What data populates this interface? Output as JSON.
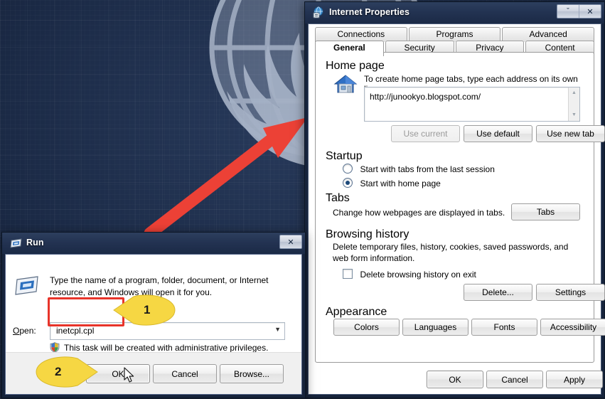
{
  "desktop": {
    "wallpaper_description": "dark navy grid wallpaper with UN-style globe and laurel emblem"
  },
  "annotations": {
    "arrow_color": "#ec4136",
    "badge_color": "#f6d743",
    "highlight_color": "#e8342a",
    "badges": [
      {
        "number": "1",
        "points": "left",
        "target": "run-open-input"
      },
      {
        "number": "2",
        "points": "right",
        "target": "run-ok-button"
      }
    ]
  },
  "internet_properties": {
    "title": "Internet Properties",
    "icon": "internet-options-icon",
    "titlebar_buttons": [
      {
        "name": "help-button",
        "glyph": "ˇ"
      },
      {
        "name": "close-button",
        "glyph": "✕"
      }
    ],
    "tabs_row1": [
      {
        "label": "Connections",
        "active": false
      },
      {
        "label": "Programs",
        "active": false
      },
      {
        "label": "Advanced",
        "active": false
      }
    ],
    "tabs_row2": [
      {
        "label": "General",
        "active": true
      },
      {
        "label": "Security",
        "active": false
      },
      {
        "label": "Privacy",
        "active": false
      },
      {
        "label": "Content",
        "active": false
      }
    ],
    "home_page": {
      "group_label": "Home page",
      "icon": "house-icon",
      "description": "To create home page tabs, type each address on its own line.",
      "value": "http://junookyo.blogspot.com/",
      "scroll_up_glyph": "▲",
      "scroll_down_glyph": "▼",
      "buttons": [
        {
          "label": "Use current",
          "disabled": true
        },
        {
          "label": "Use default",
          "disabled": false
        },
        {
          "label": "Use new tab",
          "disabled": false
        }
      ]
    },
    "startup": {
      "group_label": "Startup",
      "options": [
        {
          "label": "Start with tabs from the last session",
          "selected": false
        },
        {
          "label": "Start with home page",
          "selected": true
        }
      ]
    },
    "tabs_section": {
      "group_label": "Tabs",
      "description": "Change how webpages are displayed in tabs.",
      "button": "Tabs"
    },
    "browsing_history": {
      "group_label": "Browsing history",
      "description": "Delete temporary files, history, cookies, saved passwords, and web form information.",
      "checkbox_label": "Delete browsing history on exit",
      "checkbox_checked": false,
      "buttons": [
        {
          "label": "Delete..."
        },
        {
          "label": "Settings"
        }
      ]
    },
    "appearance": {
      "group_label": "Appearance",
      "buttons": [
        {
          "label": "Colors"
        },
        {
          "label": "Languages"
        },
        {
          "label": "Fonts"
        },
        {
          "label": "Accessibility"
        }
      ]
    },
    "footer_buttons": [
      {
        "label": "OK",
        "default": true
      },
      {
        "label": "Cancel",
        "default": false
      },
      {
        "label": "Apply",
        "default": false
      }
    ]
  },
  "run_dialog": {
    "title": "Run",
    "icon": "run-icon",
    "close_glyph": "✕",
    "description": "Type the name of a program, folder, document, or Internet resource, and Windows will open it for you.",
    "open_label": "Open:",
    "open_value": "inetcpl.cpl",
    "open_placeholder": "",
    "dropdown_glyph": "▼",
    "uac_icon": "shield-icon",
    "uac_text": "This task will be created with administrative privileges.",
    "buttons": [
      {
        "label": "OK",
        "default": true
      },
      {
        "label": "Cancel",
        "default": false
      },
      {
        "label": "Browse...",
        "default": false
      }
    ]
  }
}
